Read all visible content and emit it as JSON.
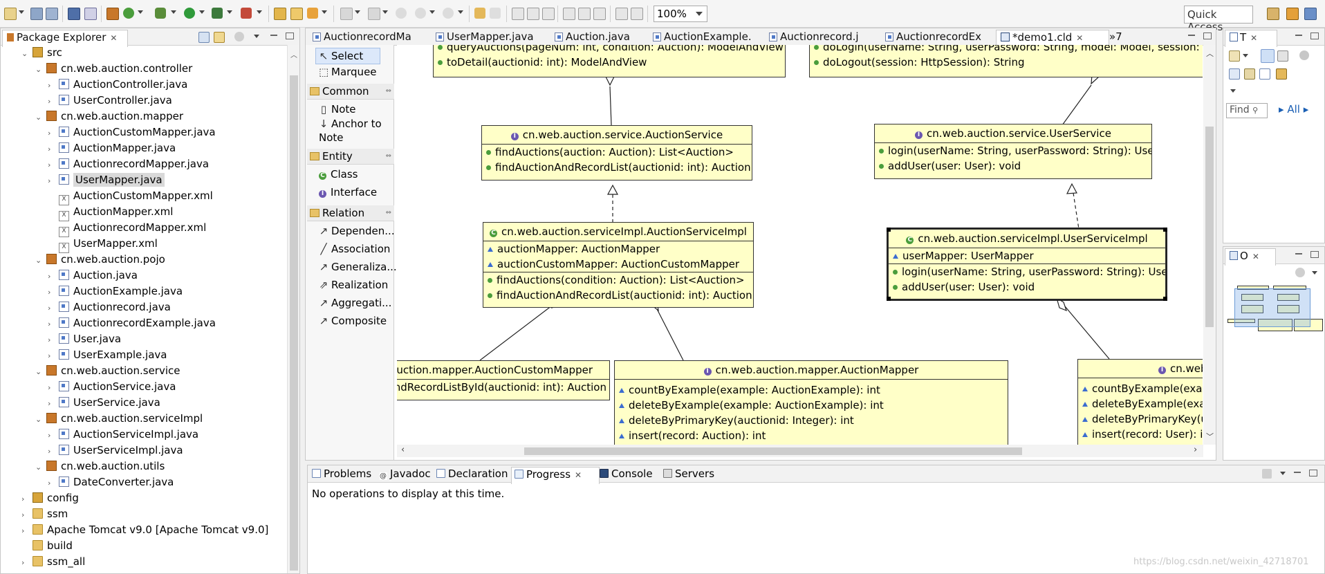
{
  "toolbar": {
    "zoom": "100%",
    "quick_access": "Quick Access"
  },
  "package_explorer": {
    "title": "Package Explorer",
    "tree": [
      {
        "label": "src",
        "kind": "srcfolder",
        "level": 1,
        "state": "open"
      },
      {
        "label": "cn.web.auction.controller",
        "kind": "package",
        "level": 2,
        "state": "open"
      },
      {
        "label": "AuctionController.java",
        "kind": "java",
        "level": 3,
        "state": "closed"
      },
      {
        "label": "UserController.java",
        "kind": "java",
        "level": 3,
        "state": "closed"
      },
      {
        "label": "cn.web.auction.mapper",
        "kind": "package",
        "level": 2,
        "state": "open"
      },
      {
        "label": "AuctionCustomMapper.java",
        "kind": "java",
        "level": 3,
        "state": "closed"
      },
      {
        "label": "AuctionMapper.java",
        "kind": "java",
        "level": 3,
        "state": "closed"
      },
      {
        "label": "AuctionrecordMapper.java",
        "kind": "java",
        "level": 3,
        "state": "closed"
      },
      {
        "label": "UserMapper.java",
        "kind": "java",
        "level": 3,
        "state": "closed",
        "selected": true
      },
      {
        "label": "AuctionCustomMapper.xml",
        "kind": "xml",
        "level": 3,
        "state": "none"
      },
      {
        "label": "AuctionMapper.xml",
        "kind": "xml",
        "level": 3,
        "state": "none"
      },
      {
        "label": "AuctionrecordMapper.xml",
        "kind": "xml",
        "level": 3,
        "state": "none"
      },
      {
        "label": "UserMapper.xml",
        "kind": "xml",
        "level": 3,
        "state": "none"
      },
      {
        "label": "cn.web.auction.pojo",
        "kind": "package",
        "level": 2,
        "state": "open"
      },
      {
        "label": "Auction.java",
        "kind": "java",
        "level": 3,
        "state": "closed"
      },
      {
        "label": "AuctionExample.java",
        "kind": "java",
        "level": 3,
        "state": "closed"
      },
      {
        "label": "Auctionrecord.java",
        "kind": "java",
        "level": 3,
        "state": "closed"
      },
      {
        "label": "AuctionrecordExample.java",
        "kind": "java",
        "level": 3,
        "state": "closed"
      },
      {
        "label": "User.java",
        "kind": "java",
        "level": 3,
        "state": "closed"
      },
      {
        "label": "UserExample.java",
        "kind": "java",
        "level": 3,
        "state": "closed"
      },
      {
        "label": "cn.web.auction.service",
        "kind": "package",
        "level": 2,
        "state": "open"
      },
      {
        "label": "AuctionService.java",
        "kind": "java",
        "level": 3,
        "state": "closed"
      },
      {
        "label": "UserService.java",
        "kind": "java",
        "level": 3,
        "state": "closed"
      },
      {
        "label": "cn.web.auction.serviceImpl",
        "kind": "package",
        "level": 2,
        "state": "open"
      },
      {
        "label": "AuctionServiceImpl.java",
        "kind": "java",
        "level": 3,
        "state": "closed"
      },
      {
        "label": "UserServiceImpl.java",
        "kind": "java",
        "level": 3,
        "state": "closed"
      },
      {
        "label": "cn.web.auction.utils",
        "kind": "package",
        "level": 2,
        "state": "open"
      },
      {
        "label": "DateConverter.java",
        "kind": "java",
        "level": 3,
        "state": "closed"
      },
      {
        "label": "config",
        "kind": "srcfolder",
        "level": 1,
        "state": "closed"
      },
      {
        "label": "ssm",
        "kind": "lib",
        "level": 1,
        "state": "closed"
      },
      {
        "label": "Apache Tomcat v9.0 [Apache Tomcat v9.0]",
        "kind": "lib",
        "level": 1,
        "state": "closed"
      },
      {
        "label": "build",
        "kind": "folder",
        "level": 1,
        "state": "none"
      },
      {
        "label": "ssm_all",
        "kind": "folder",
        "level": 1,
        "state": "closed"
      }
    ]
  },
  "editor_tabs": [
    {
      "label": "AuctionrecordMa"
    },
    {
      "label": "UserMapper.java"
    },
    {
      "label": "Auction.java"
    },
    {
      "label": "AuctionExample."
    },
    {
      "label": "Auctionrecord.j"
    },
    {
      "label": "AuctionrecordEx"
    },
    {
      "label": "*demo1.cld",
      "active": true
    }
  ],
  "editor_overflow": "»7",
  "palette": {
    "tools": [
      "Select",
      "Marquee"
    ],
    "groups": [
      {
        "title": "Common",
        "items": [
          "Note",
          "Anchor to Note"
        ]
      },
      {
        "title": "Entity",
        "items": [
          "Class",
          "Interface"
        ]
      },
      {
        "title": "Relation",
        "items": [
          "Dependen...",
          "Association",
          "Generaliza...",
          "Realization",
          "Aggregati...",
          "Composite"
        ]
      }
    ]
  },
  "diagram": {
    "controller_left_cut": "queryAuctions(pageNum: int, condition: Auction): ModelAndView",
    "controller_left_last": "toDetail(auctionid: int): ModelAndView",
    "controller_right_cut": "doLogin(userName: String, userPassword: String, model: Model, session: HttpSession): String",
    "controller_right_last": "doLogout(session: HttpSession): String",
    "auction_service": {
      "name": "cn.web.auction.service.AuctionService",
      "methods": [
        "findAuctions(auction: Auction): List<Auction>",
        "findAuctionAndRecordList(auctionid: int): Auction"
      ]
    },
    "user_service": {
      "name": "cn.web.auction.service.UserService",
      "methods": [
        "login(userName: String, userPassword: String): User",
        "addUser(user: User): void"
      ]
    },
    "auction_service_impl": {
      "name": "cn.web.auction.serviceImpl.AuctionServiceImpl",
      "fields": [
        "auctionMapper: AuctionMapper",
        "auctionCustomMapper: AuctionCustomMapper"
      ],
      "methods": [
        "findAuctions(condition: Auction): List<Auction>",
        "findAuctionAndRecordList(auctionid: int): Auction"
      ]
    },
    "user_service_impl": {
      "name": "cn.web.auction.serviceImpl.UserServiceImpl",
      "fields": [
        "userMapper: UserMapper"
      ],
      "methods": [
        "login(userName: String, userPassword: String): User",
        "addUser(user: User): void"
      ]
    },
    "auction_custom_mapper": {
      "name": "cn.web.auction.mapper.AuctionCustomMapper",
      "methods": [
        "findAuctionAndRecordListById(auctionid: int): Auction"
      ]
    },
    "auction_mapper": {
      "name": "cn.web.auction.mapper.AuctionMapper",
      "methods": [
        "countByExample(example: AuctionExample): int",
        "deleteByExample(example: AuctionExample): int",
        "deleteByPrimaryKey(auctionid: Integer): int",
        "insert(record: Auction): int"
      ]
    },
    "user_mapper": {
      "name": "cn.web.auction.mapper.UserMapper",
      "methods": [
        "countByExample(example: UserExample): int",
        "deleteByExample(example: UserExample): int",
        "deleteByPrimaryKey(userid: Integer): int",
        "insert(record: User): int"
      ]
    }
  },
  "right_panels": {
    "tasks_title": "T",
    "find_placeholder": "Find",
    "all_label": "All",
    "outline_title": "O"
  },
  "bottom": {
    "tabs": [
      {
        "label": "Problems"
      },
      {
        "label": "Javadoc"
      },
      {
        "label": "Declaration"
      },
      {
        "label": "Progress",
        "active": true
      },
      {
        "label": "Console"
      },
      {
        "label": "Servers"
      }
    ],
    "message": "No operations to display at this time."
  },
  "watermark": "https://blog.csdn.net/weixin_42718701"
}
